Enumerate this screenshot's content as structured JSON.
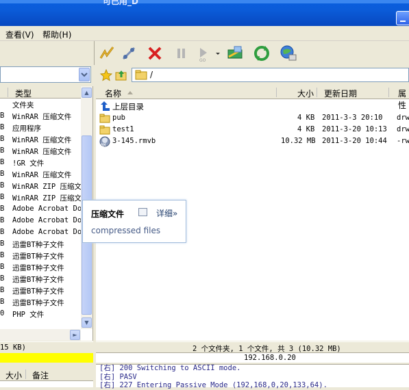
{
  "window": {
    "title": "可已用_D"
  },
  "menu": {
    "items": [
      "查看(V)",
      "帮助(H)"
    ]
  },
  "address": {
    "path": "/"
  },
  "left_pane": {
    "header": {
      "col1": "",
      "col2": "类型"
    },
    "rows": [
      {
        "size": "",
        "type": "文件夹"
      },
      {
        "size": "B",
        "type": "WinRAR 压缩文件"
      },
      {
        "size": "B",
        "type": "应用程序"
      },
      {
        "size": "B",
        "type": "WinRAR 压缩文件"
      },
      {
        "size": "B",
        "type": "WinRAR 压缩文件"
      },
      {
        "size": "B",
        "type": "!GR 文件"
      },
      {
        "size": "B",
        "type": "WinRAR 压缩文件"
      },
      {
        "size": "B",
        "type": "WinRAR ZIP 压缩文"
      },
      {
        "size": "B",
        "type": "WinRAR ZIP 压缩文"
      },
      {
        "size": "B",
        "type": "Adobe Acrobat Doc"
      },
      {
        "size": "B",
        "type": "Adobe Acrobat Doc"
      },
      {
        "size": "B",
        "type": "Adobe Acrobat Doc"
      },
      {
        "size": "B",
        "type": "迅雷BT种子文件"
      },
      {
        "size": "B",
        "type": "迅雷BT种子文件"
      },
      {
        "size": "B",
        "type": "迅雷BT种子文件"
      },
      {
        "size": "B",
        "type": "迅雷BT种子文件"
      },
      {
        "size": "B",
        "type": "迅雷BT种子文件"
      },
      {
        "size": "B",
        "type": "迅雷BT种子文件"
      },
      {
        "size": "0",
        "type": "PHP 文件"
      }
    ],
    "status": "15 KB)",
    "bottom_header": {
      "size": "大小",
      "note": "备注"
    }
  },
  "right_pane": {
    "header": {
      "name": "名称",
      "size": "大小",
      "date": "更新日期",
      "attr": "属性"
    },
    "rows": [
      {
        "name": "上层目录",
        "size": "",
        "date": "",
        "attr": "",
        "icon": "up-arrow-icon"
      },
      {
        "name": "pub",
        "size": "4 KB",
        "date": "2011-3-3 20:10",
        "attr": "drw",
        "icon": "folder-icon"
      },
      {
        "name": "test1",
        "size": "4 KB",
        "date": "2011-3-20 10:13",
        "attr": "drw",
        "icon": "folder-icon"
      },
      {
        "name": "3-145.rmvb",
        "size": "10.32 MB",
        "date": "2011-3-20 10:44",
        "attr": "-rw",
        "icon": "realmedia-icon"
      }
    ],
    "status": "2 个文件夹, 1 个文件, 共 3 (10.32 MB)",
    "ip": "192.168.0.20"
  },
  "tooltip": {
    "title": "压缩文件",
    "detail": "详细»",
    "description": "compressed files"
  },
  "log": {
    "lines": [
      "[右] 200 Switching to ASCII mode.",
      "[右] PASV",
      "[右] 227 Entering Passive Mode (192,168,0,20,133,64)."
    ]
  }
}
